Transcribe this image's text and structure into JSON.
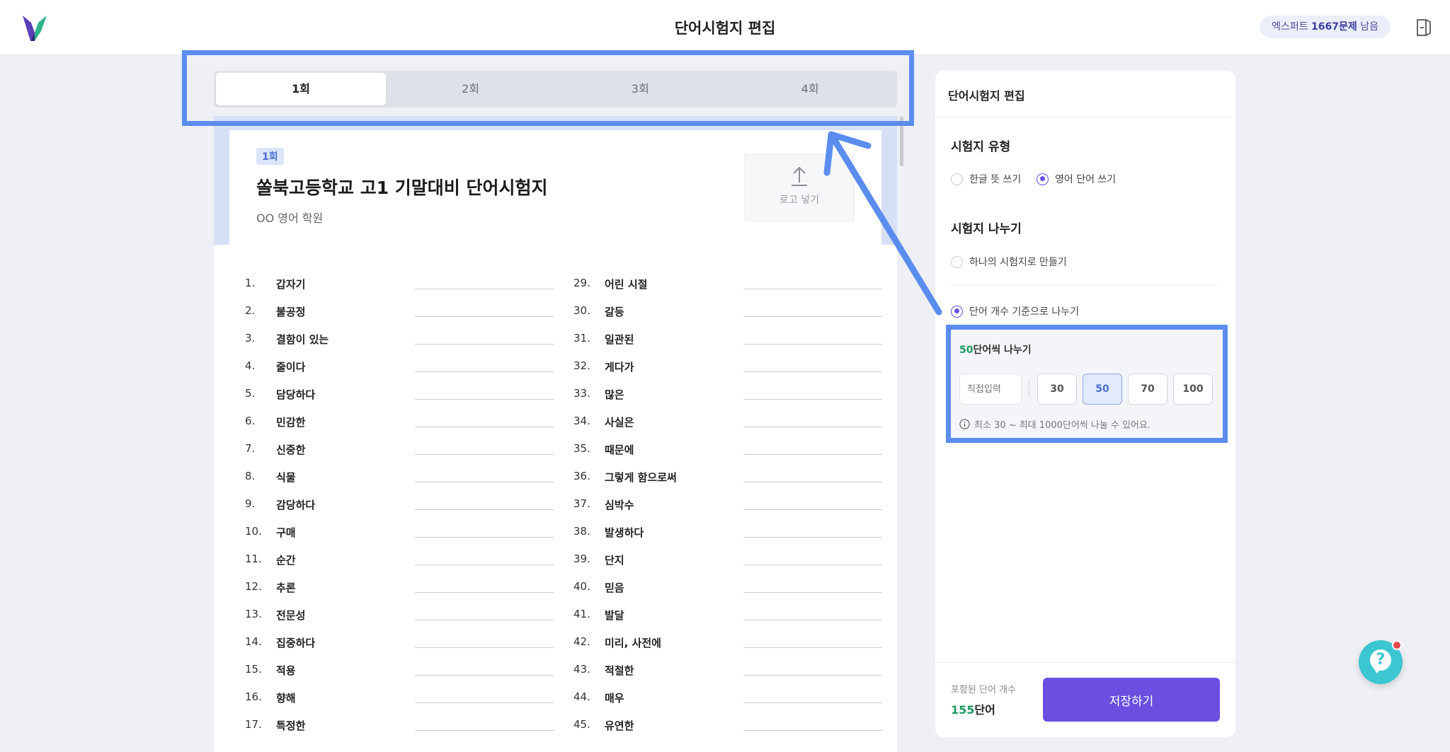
{
  "header": {
    "title": "단어시험지 편집",
    "badge_prefix": "엑스퍼트 ",
    "badge_count": "1667문제",
    "badge_suffix": " 남음"
  },
  "tabs": [
    {
      "label": "1회"
    },
    {
      "label": "2회"
    },
    {
      "label": "3회"
    },
    {
      "label": "4회"
    }
  ],
  "paper": {
    "round_chip": "1회",
    "title": "쏠북고등학교 고1 기말대비 단어시험지",
    "subtitle": "OO 영어 학원",
    "logo_upload_label": "로고 넣기"
  },
  "words_left": [
    {
      "num": "1.",
      "word": "갑자기"
    },
    {
      "num": "2.",
      "word": "불공정"
    },
    {
      "num": "3.",
      "word": "결함이 있는"
    },
    {
      "num": "4.",
      "word": "줄이다"
    },
    {
      "num": "5.",
      "word": "담당하다"
    },
    {
      "num": "6.",
      "word": "민감한"
    },
    {
      "num": "7.",
      "word": "신중한"
    },
    {
      "num": "8.",
      "word": "식물"
    },
    {
      "num": "9.",
      "word": "감당하다"
    },
    {
      "num": "10.",
      "word": "구매"
    },
    {
      "num": "11.",
      "word": "순간"
    },
    {
      "num": "12.",
      "word": "추론"
    },
    {
      "num": "13.",
      "word": "전문성"
    },
    {
      "num": "14.",
      "word": "집중하다"
    },
    {
      "num": "15.",
      "word": "적용"
    },
    {
      "num": "16.",
      "word": "향해"
    },
    {
      "num": "17.",
      "word": "특정한"
    }
  ],
  "words_right": [
    {
      "num": "29.",
      "word": "어린 시절"
    },
    {
      "num": "30.",
      "word": "갈등"
    },
    {
      "num": "31.",
      "word": "일관된"
    },
    {
      "num": "32.",
      "word": "게다가"
    },
    {
      "num": "33.",
      "word": "많은"
    },
    {
      "num": "34.",
      "word": "사실은"
    },
    {
      "num": "35.",
      "word": "때문에"
    },
    {
      "num": "36.",
      "word": "그렇게 함으로써"
    },
    {
      "num": "37.",
      "word": "심박수"
    },
    {
      "num": "38.",
      "word": "발생하다"
    },
    {
      "num": "39.",
      "word": "단지"
    },
    {
      "num": "40.",
      "word": "믿음"
    },
    {
      "num": "41.",
      "word": "발달"
    },
    {
      "num": "42.",
      "word": "미리, 사전에"
    },
    {
      "num": "43.",
      "word": "적절한"
    },
    {
      "num": "44.",
      "word": "매우"
    },
    {
      "num": "45.",
      "word": "유연한"
    }
  ],
  "panel": {
    "title": "단어시험지 편집",
    "type_section": "시험지 유형",
    "type_options": [
      "한글 뜻 쓰기",
      "영어 단어 쓰기"
    ],
    "split_section": "시험지 나누기",
    "split_options": [
      "하나의 시험지로 만들기",
      "단어 개수 기준으로 나누기"
    ],
    "split_count": "50",
    "split_suffix": "단어씩 나누기",
    "direct_input_placeholder": "직접입력",
    "count_options": [
      "30",
      "50",
      "70",
      "100"
    ],
    "hint": "최소 30 ~ 최대 1000단어씩 나눌 수 있어요.",
    "included_label": "포함된 단어 개수",
    "included_count": "155",
    "included_unit": "단어",
    "save_label": "저장하기"
  },
  "colors": {
    "accent": "#6b4fe0",
    "annotation": "#5b8def",
    "green": "#1e9a5f",
    "help": "#3cc6d1"
  }
}
